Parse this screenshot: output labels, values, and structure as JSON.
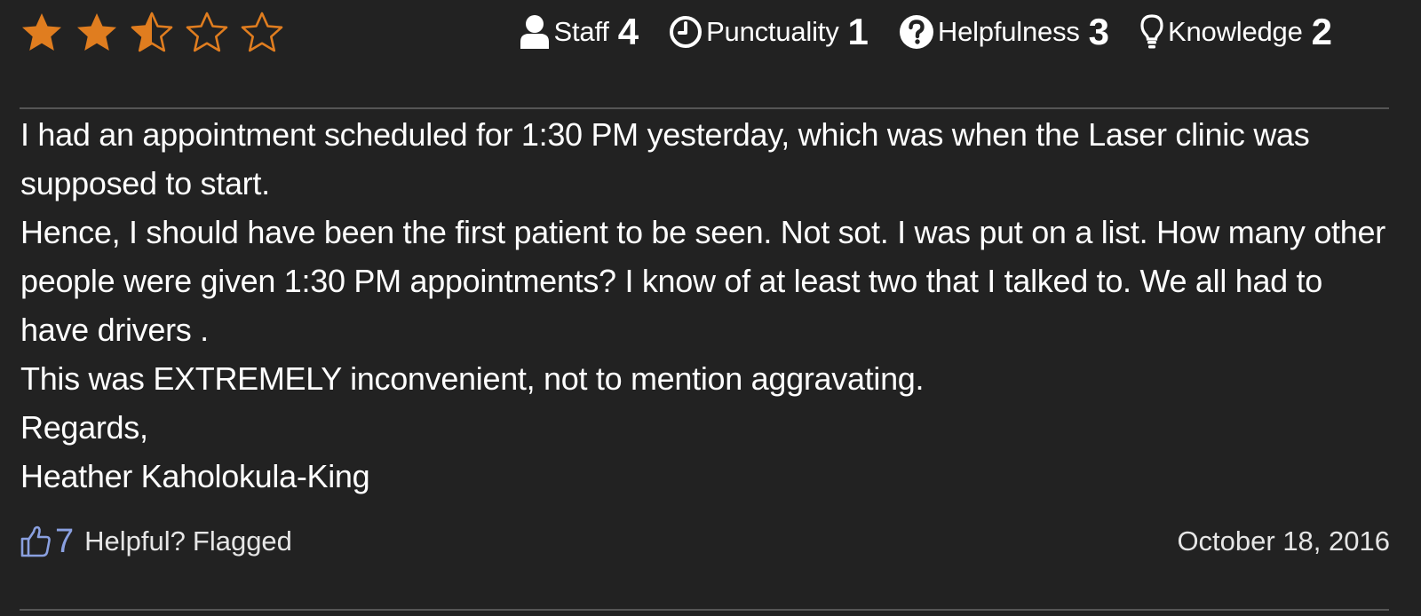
{
  "review": {
    "star_rating": 2.5,
    "star_max": 5,
    "star_color": "#e07d1f",
    "ratings": [
      {
        "icon": "user-icon",
        "label": "Staff",
        "value": "4"
      },
      {
        "icon": "clock-icon",
        "label": "Punctuality",
        "value": "1"
      },
      {
        "icon": "question-circle-icon",
        "label": "Helpfulness",
        "value": "3"
      },
      {
        "icon": "lightbulb-icon",
        "label": "Knowledge",
        "value": "2"
      }
    ],
    "body": [
      "I had an appointment scheduled for 1:30 PM yesterday, which was when the Laser clinic was supposed to start.",
      "Hence, I should have been the first patient to be seen. Not sot. I was put on a list. How many other people were given 1:30 PM appointments? I know of at least two that I talked to. We all had to have drivers .",
      "This was EXTREMELY inconvenient, not to mention aggravating.",
      "Regards,",
      "Heather Kaholokula-King"
    ],
    "footer": {
      "helpful_count": "7",
      "helpful_label": "Helpful?",
      "flag_label": "Flagged",
      "date": "October 18, 2016",
      "accent_color": "#8aa0e0"
    }
  }
}
